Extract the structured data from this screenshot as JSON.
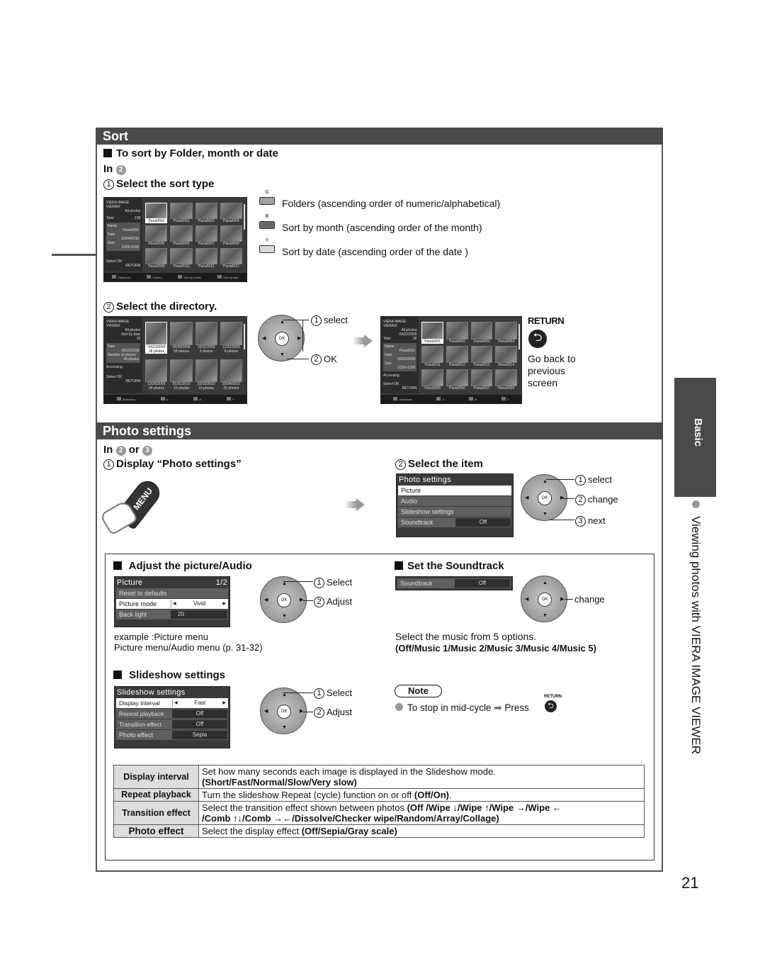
{
  "page_number": "21",
  "side_tab": {
    "label": "Basic",
    "title": "Viewing photos with VIERA IMAGE VIEWER"
  },
  "sort": {
    "header": "Sort",
    "subheading": "To sort by Folder, month or date",
    "context": "In",
    "context_step": "2",
    "step1": {
      "num": "1",
      "label": "Select the sort type"
    },
    "keys": [
      {
        "key": "G",
        "color": "#a0a0a0",
        "desc": "Folders (ascending order of numeric/alphabetical)"
      },
      {
        "key": "B",
        "color": "#6a6a6a",
        "desc": "Sort by month (ascending order of the month)"
      },
      {
        "key": "Y",
        "color": "#d8d8d8",
        "desc": "Sort by date (ascending order of the date )"
      }
    ],
    "screen1": {
      "app": "VIERA IMAGE VIEWER",
      "mode": "All photos",
      "total_label": "Total",
      "total": "238",
      "name_label": "Name",
      "name": "Pana0001",
      "date_label": "Date",
      "date": "03/04/2010",
      "size_label": "Size",
      "size": "1029×1200",
      "select_label": "Select",
      "ok_label": "OK",
      "return_label": "RETURN",
      "thumbs": [
        "Pana0001",
        "Pana0002",
        "Pana0003",
        "Pana0004",
        "Pana0005",
        "Pana0006",
        "Pana0007",
        "Pana0008",
        "Pana0009",
        "Pana0010",
        "Pana0011",
        "Pana0012"
      ],
      "bar": [
        "Slideshow",
        "Folders",
        "Sort by month",
        "Sort by date"
      ]
    },
    "step2": {
      "num": "2",
      "label": "Select the directory."
    },
    "screen2": {
      "app": "VIERA IMAGE VIEWER",
      "mode": "All photos",
      "sort": "Sort by date",
      "count": "15",
      "date_label": "Date",
      "date": "09/23/2009",
      "num_label": "Number of photos",
      "num": "28 photos",
      "accessing": "Accessing",
      "select_label": "Select",
      "ok_label": "OK",
      "return_label": "RETURN",
      "thumbs": [
        {
          "date": "09/23/2009",
          "count": "28 photos"
        },
        {
          "date": "09/28/2009",
          "count": "58 photos"
        },
        {
          "date": "10/10/2009",
          "count": "3 photos"
        },
        {
          "date": "11/20/2009",
          "count": "8 photos"
        },
        {
          "date": "12/25/2009",
          "count": "24 photos"
        },
        {
          "date": "01/01/2010",
          "count": "10 photos"
        },
        {
          "date": "02/15/2010",
          "count": "16 photos"
        },
        {
          "date": "03/04/2010",
          "count": "32 photos"
        }
      ],
      "bar": [
        "Slideshow",
        "G",
        "B",
        "Y"
      ]
    },
    "dpad_callouts": {
      "select": "select",
      "ok": "OK",
      "select_num": "1",
      "ok_num": "2"
    },
    "screen3": {
      "app": "VIERA IMAGE VIEWER",
      "mode": "All photos",
      "date_top": "09/23/2009",
      "total_label": "Total",
      "total": "28",
      "name_label": "Name",
      "name": "Pana0001",
      "date_label": "Date",
      "date": "09/23/2009",
      "size_label": "Size",
      "size": "1029×1200",
      "accessing": "Accessing",
      "select_label": "Select",
      "ok_label": "OK",
      "return_label": "RETURN",
      "thumbs": [
        "Pana0001",
        "Pana0002",
        "Pana0003",
        "Pana0004",
        "Pana0011",
        "Pana0012",
        "Pana0013",
        "Pana0014",
        "Pana0055",
        "Pana0056",
        "Pana0057",
        "Pana0058"
      ],
      "bar": [
        "Slideshow",
        "G",
        "B",
        "Y"
      ]
    },
    "return": {
      "label": "RETURN",
      "desc1": "Go back to",
      "desc2": "previous",
      "desc3": "screen"
    }
  },
  "photo_settings": {
    "header": "Photo settings",
    "context": "In",
    "context_step_a": "2",
    "context_or": "or",
    "context_step_b": "3",
    "step1": {
      "num": "1",
      "label": "Display “Photo settings”"
    },
    "menu_button": "MENU",
    "step2": {
      "num": "2",
      "label": "Select the item"
    },
    "menu": {
      "title": "Photo settings",
      "items": [
        "Picture",
        "Audio",
        "Slideshow settings"
      ],
      "soundtrack_label": "Soundtrack",
      "soundtrack_value": "Off"
    },
    "callouts": [
      {
        "num": "1",
        "label": "select"
      },
      {
        "num": "2",
        "label": "change"
      },
      {
        "num": "3",
        "label": "next"
      }
    ],
    "adjust": {
      "heading": "Adjust the picture/Audio",
      "menu_title": "Picture",
      "menu_page": "1/2",
      "rows": [
        {
          "label": "Reset to defaults",
          "value": ""
        },
        {
          "label": "Picture mode",
          "value": "Vivid"
        },
        {
          "label": "Back light",
          "value": "20"
        }
      ],
      "callouts": [
        {
          "num": "1",
          "label": "Select"
        },
        {
          "num": "2",
          "label": "Adjust"
        }
      ],
      "note1": "example :Picture menu",
      "note2": "Picture menu/Audio menu (p. 31-32)"
    },
    "soundtrack": {
      "heading": "Set the Soundtrack",
      "label": "Soundtrack",
      "value": "Off",
      "callout": "change",
      "desc": "Select the music from 5 options.",
      "options": "(Off/Music 1/Music 2/Music 3/Music 4/Music 5)"
    },
    "slideshow": {
      "heading": "Slideshow settings",
      "menu_title": "Slideshow settings",
      "rows": [
        {
          "label": "Display interval",
          "value": "Fast"
        },
        {
          "label": "Repeat playback",
          "value": "Off"
        },
        {
          "label": "Transition effect",
          "value": "Off"
        },
        {
          "label": "Photo effect",
          "value": "Sepia"
        }
      ],
      "callouts": [
        {
          "num": "1",
          "label": "Select"
        },
        {
          "num": "2",
          "label": "Adjust"
        }
      ]
    },
    "note": {
      "title": "Note",
      "text": "To stop in mid-cycle",
      "press": "Press",
      "return_small": "RETURN"
    },
    "table": [
      {
        "key": "Display interval",
        "line1": "Set how many seconds each image is displayed in the Slideshow mode.",
        "line2_bold": "(Short/Fast/Normal/Slow/Very slow)"
      },
      {
        "key": "Repeat playback",
        "text": "Turn the slideshow Repeat (cycle) function on or off ",
        "bold": "(Off/On)",
        "tail": "."
      },
      {
        "key": "Transition effect",
        "line1": "Select the transition effect shown between photos ",
        "line1_bold": "(Off /Wipe ↓/Wipe ↑/Wipe →/Wipe ←",
        "line2_bold": "/Comb ↑↓/Comb →←/Dissolve/Checker wipe/Random/Array/Collage)"
      },
      {
        "key": "Photo effect",
        "text": "Select the display effect ",
        "bold": "(Off/Sepia/Gray scale)",
        "tail": ""
      }
    ]
  }
}
